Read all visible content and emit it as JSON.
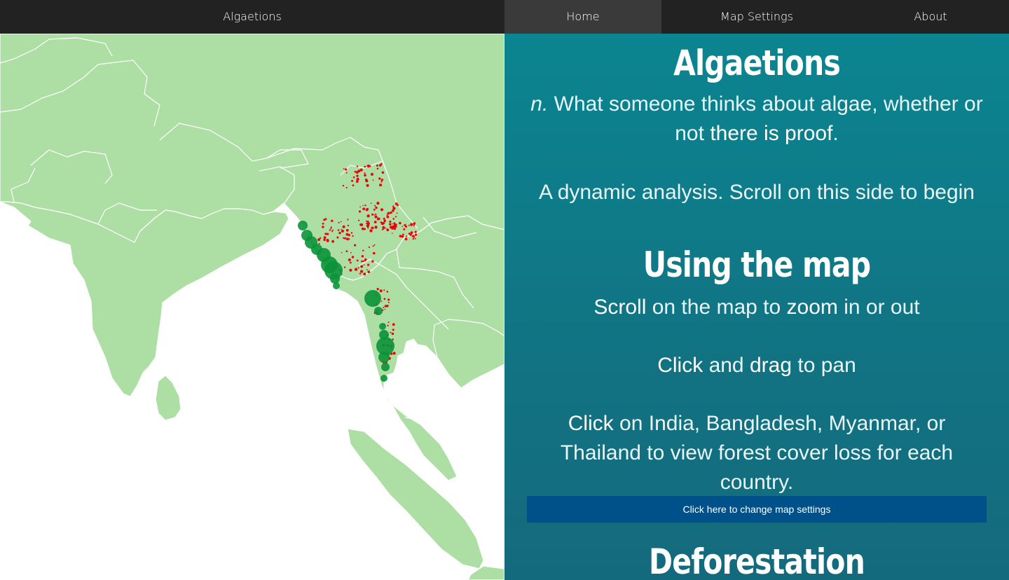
{
  "nav": {
    "brand": "Algaetions",
    "items": [
      {
        "label": "Home",
        "active": true
      },
      {
        "label": "Map Settings",
        "active": false
      },
      {
        "label": "About",
        "active": false
      }
    ]
  },
  "map": {
    "land_color": "#addfa5",
    "border_color": "#ffffff",
    "deforestation_point_color": "#e8060a",
    "algae_bubble_color": "#0a9438"
  },
  "panel": {
    "title": "Algaetions",
    "definition": {
      "pos": "n.",
      "text_a": "What someone thinks about algae, whether or not",
      "text_b": "there is proof."
    },
    "subtitle": "A dynamic analysis. Scroll on this side to begin",
    "using_heading": "Using the map",
    "scroll_line": {
      "w1": "Scroll",
      "t1": "on the map to",
      "w2": "zoom",
      "t2": "in or out"
    },
    "drag_line": {
      "w1": "Click",
      "t1": "and",
      "w2": "drag",
      "t2": "to pan"
    },
    "click_line": {
      "w1": "Click",
      "t1": "on India, Bangladesh, Myanmar, or Thailand to view forest cover loss for each country."
    },
    "settings_button": {
      "w1": "Click",
      "t1": "here to change map settings"
    },
    "deforestation_heading": "Deforestation",
    "colors": {
      "panel_top": "#0b8591",
      "panel_bottom": "#146a7d",
      "button": "#00508a"
    }
  }
}
